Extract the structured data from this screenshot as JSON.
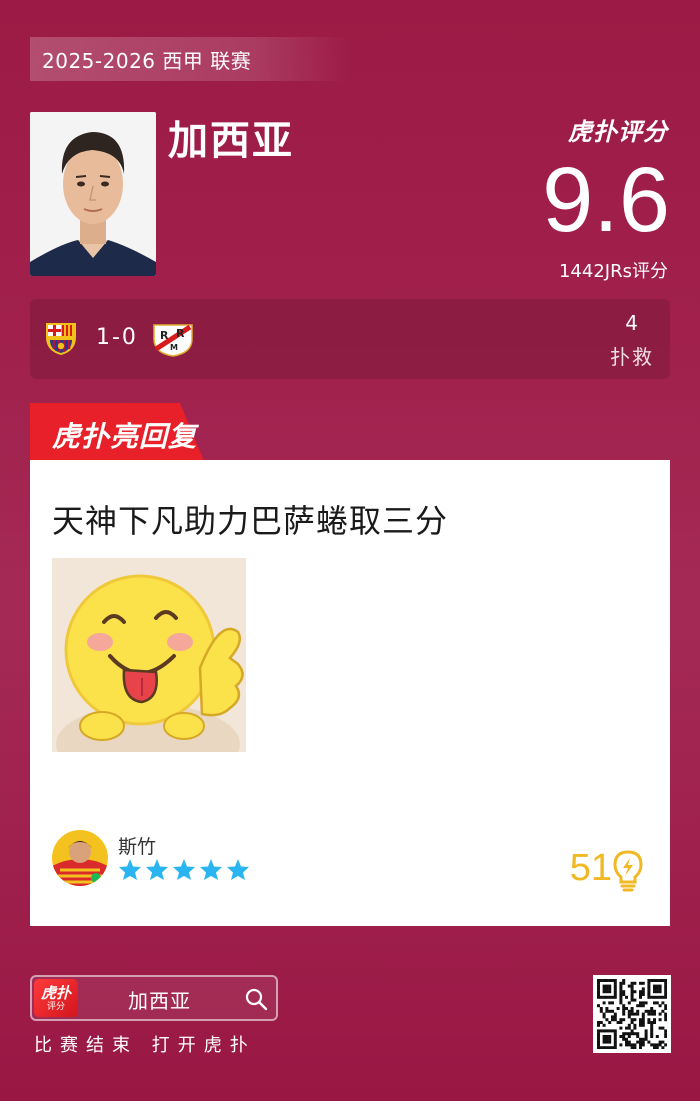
{
  "league": {
    "label": "2025-2026 西甲 联赛"
  },
  "player": {
    "name": "加西亚"
  },
  "rating": {
    "logo": "虎扑评分",
    "score": "9.6",
    "votes": "1442JRs评分"
  },
  "match": {
    "home_crest": "fc-barcelona-crest",
    "away_crest": "rayo-vallecano-crest",
    "score": "1-0",
    "stat_value": "4",
    "stat_label": "扑救"
  },
  "tab": {
    "label": "虎扑亮回复"
  },
  "reply": {
    "text": "天神下凡助力巴萨蜷取三分",
    "image": "smiling-emoji-thumbs-up",
    "user": "斯竹",
    "stars": 5,
    "likes": "51",
    "like_icon": "lightbulb-icon"
  },
  "footer": {
    "app_icon_line1": "虎扑",
    "app_icon_line2": "评分",
    "search_term": "加西亚",
    "caption": "比赛结束 打开虎扑"
  },
  "colors": {
    "background": "#9f1f4c",
    "tab_red": "#e8202a",
    "star_blue": "#2bb5f0",
    "likes_gold": "#f0b824"
  }
}
